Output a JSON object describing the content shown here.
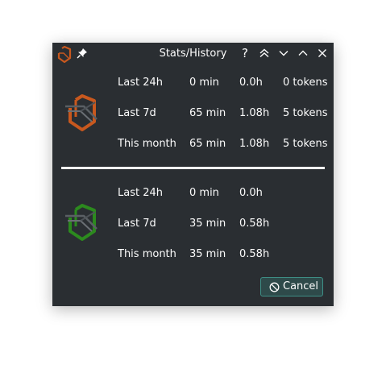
{
  "window": {
    "title": "Stats/History",
    "icons": {
      "app": "orange-shield-logo-icon",
      "pin": "pin-icon",
      "help": "help-icon",
      "keep_above": "keep-above-icon",
      "keep_below": "keep-below-icon",
      "maximize": "maximize-icon",
      "close": "close-icon"
    },
    "help_glyph": "?"
  },
  "colors": {
    "background": "#2a2e32",
    "text": "#fcfcfc",
    "orange_logo": "#c8581e",
    "green_logo": "#2c8a1e",
    "button_border": "#3e8f86",
    "button_bg": "#2e4a4a"
  },
  "sections": [
    {
      "logo": "orange-shield-logo-icon",
      "rows": [
        {
          "period": "Last 24h",
          "minutes": "0 min",
          "hours": "0.0h",
          "tokens": "0 tokens"
        },
        {
          "period": "Last 7d",
          "minutes": "65 min",
          "hours": "1.08h",
          "tokens": "5 tokens"
        },
        {
          "period": "This month",
          "minutes": "65 min",
          "hours": "1.08h",
          "tokens": "5 tokens"
        }
      ]
    },
    {
      "logo": "green-shield-logo-icon",
      "rows": [
        {
          "period": "Last 24h",
          "minutes": "0 min",
          "hours": "0.0h"
        },
        {
          "period": "Last 7d",
          "minutes": "35 min",
          "hours": "0.58h"
        },
        {
          "period": "This month",
          "minutes": "35 min",
          "hours": "0.58h"
        }
      ]
    }
  ],
  "buttons": {
    "cancel_label": "Cancel",
    "cancel_icon": "cancel-icon"
  }
}
